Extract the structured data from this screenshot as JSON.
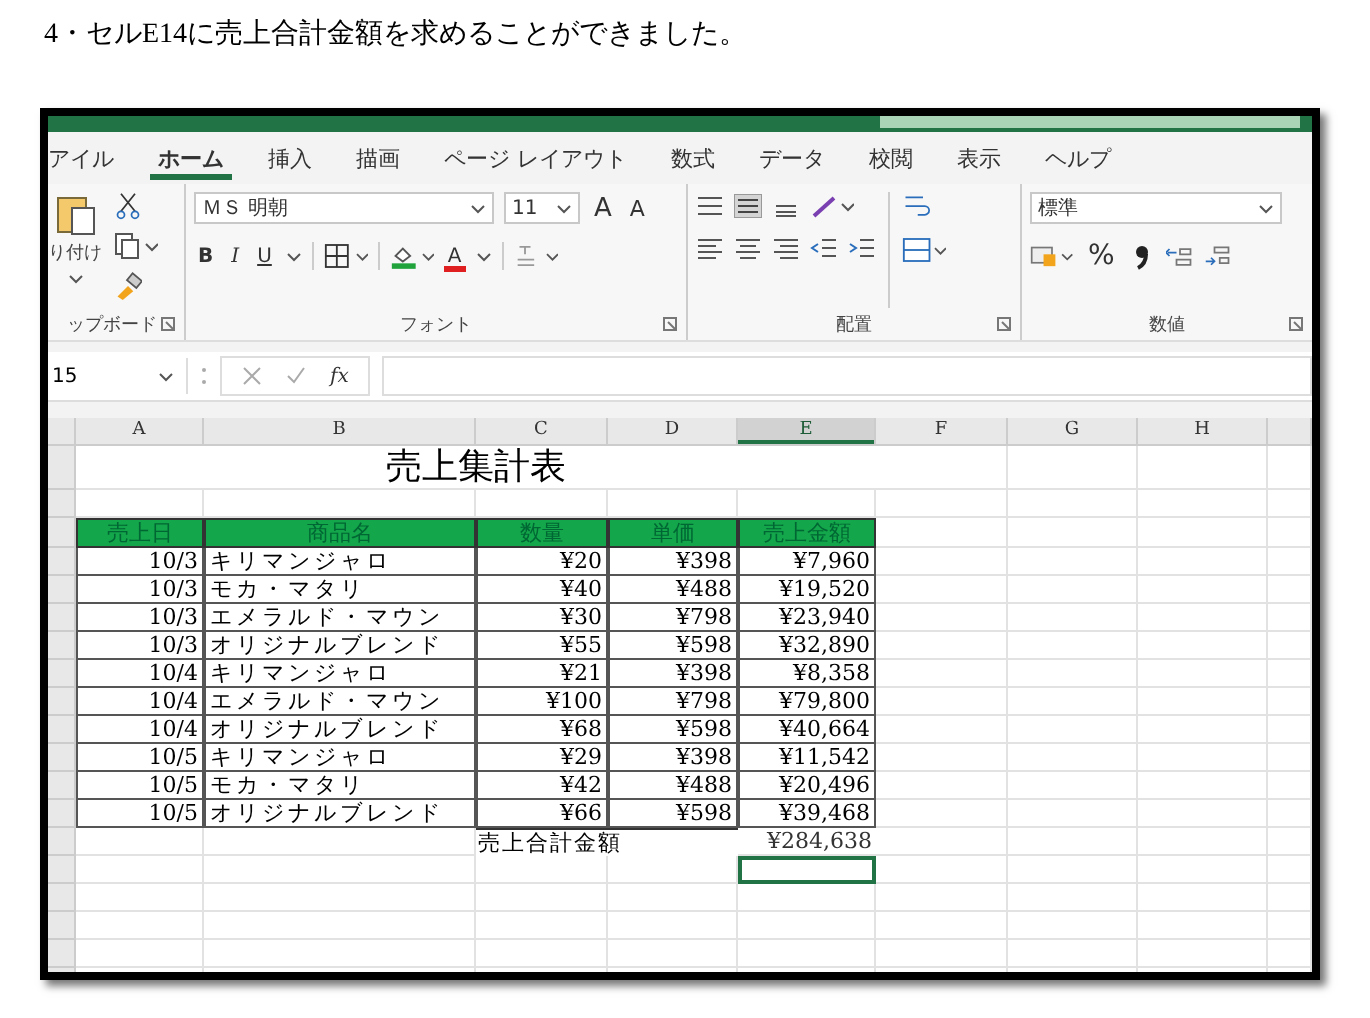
{
  "caption": "4・セルE14に売上合計金額を求めることができました。",
  "tabs": [
    {
      "label": "アイル",
      "selected": false
    },
    {
      "label": "ホーム",
      "selected": true
    },
    {
      "label": "挿入",
      "selected": false
    },
    {
      "label": "描画",
      "selected": false
    },
    {
      "label": "ページ レイアウト",
      "selected": false
    },
    {
      "label": "数式",
      "selected": false
    },
    {
      "label": "データ",
      "selected": false
    },
    {
      "label": "校閲",
      "selected": false
    },
    {
      "label": "表示",
      "selected": false
    },
    {
      "label": "ヘルプ",
      "selected": false
    }
  ],
  "ribbon": {
    "paste_label": "り付け",
    "clipboard_label": "ップボード",
    "font_name": "ＭＳ 明朝",
    "font_size": "11",
    "grow_label": "A",
    "shrink_label": "A",
    "style_buttons": [
      "B",
      "I",
      "U"
    ],
    "font_color_label": "A",
    "font_label": "フォント",
    "alignment_label": "配置",
    "number_format": "標準",
    "percent_label": "%",
    "number_label": "数値"
  },
  "formula_bar": {
    "name_box": "15",
    "fx_label": "fx"
  },
  "sheet": {
    "columns": [
      {
        "label": "A",
        "selected": false
      },
      {
        "label": "B",
        "selected": false
      },
      {
        "label": "C",
        "selected": false
      },
      {
        "label": "D",
        "selected": false
      },
      {
        "label": "E",
        "selected": true
      },
      {
        "label": "F",
        "selected": false
      },
      {
        "label": "G",
        "selected": false
      },
      {
        "label": "H",
        "selected": false
      }
    ],
    "title": "売上集計表",
    "headers": [
      "売上日",
      "商品名",
      "数量",
      "単価",
      "売上金額"
    ],
    "rows": [
      [
        "10/3",
        "キリマンジャロ",
        "¥20",
        "¥398",
        "¥7,960"
      ],
      [
        "10/3",
        "モカ・マタリ",
        "¥40",
        "¥488",
        "¥19,520"
      ],
      [
        "10/3",
        "エメラルド・マウン",
        "¥30",
        "¥798",
        "¥23,940"
      ],
      [
        "10/3",
        "オリジナルブレンド",
        "¥55",
        "¥598",
        "¥32,890"
      ],
      [
        "10/4",
        "キリマンジャロ",
        "¥21",
        "¥398",
        "¥8,358"
      ],
      [
        "10/4",
        "エメラルド・マウン",
        "¥100",
        "¥798",
        "¥79,800"
      ],
      [
        "10/4",
        "オリジナルブレンド",
        "¥68",
        "¥598",
        "¥40,664"
      ],
      [
        "10/5",
        "キリマンジャロ",
        "¥29",
        "¥398",
        "¥11,542"
      ],
      [
        "10/5",
        "モカ・マタリ",
        "¥42",
        "¥488",
        "¥20,496"
      ],
      [
        "10/5",
        "オリジナルブレンド",
        "¥66",
        "¥598",
        "¥39,468"
      ]
    ],
    "total_label": "売上合計金額",
    "total_value": "¥284,638"
  }
}
